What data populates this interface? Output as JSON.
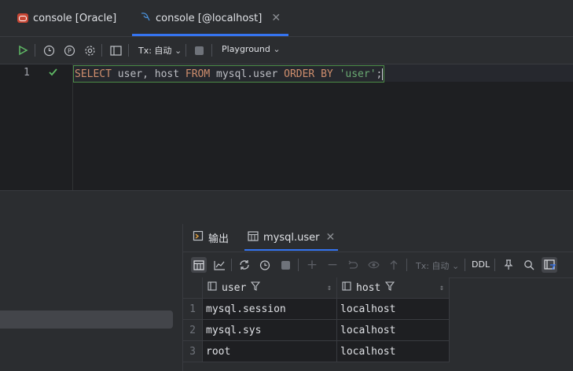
{
  "tabs": [
    {
      "label": "console [Oracle]",
      "active": false
    },
    {
      "label": "console [@localhost]",
      "active": true
    }
  ],
  "toolbar": {
    "tx_label": "Tx: 自动",
    "playground_label": "Playground"
  },
  "editor": {
    "line_number": "1",
    "sql": {
      "kw_select": "SELECT",
      "cols": " user, host ",
      "kw_from": "FROM",
      "table": " mysql.user ",
      "kw_order": "ORDER BY",
      "space": " ",
      "literal": "'user'",
      "end": ";"
    }
  },
  "results": {
    "tabs": [
      {
        "label": "输出"
      },
      {
        "label": "mysql.user"
      }
    ],
    "toolbar": {
      "tx_label": "Tx: 自动",
      "ddl_label": "DDL"
    },
    "columns": [
      "user",
      "host"
    ],
    "rows": [
      {
        "n": "1",
        "user": "mysql.session",
        "host": "localhost"
      },
      {
        "n": "2",
        "user": "mysql.sys",
        "host": "localhost"
      },
      {
        "n": "3",
        "user": "root",
        "host": "localhost"
      }
    ]
  },
  "colors": {
    "accent": "#3574f0",
    "keyword": "#cf8e6d",
    "string": "#6aab73",
    "run_green": "#5fb865"
  }
}
